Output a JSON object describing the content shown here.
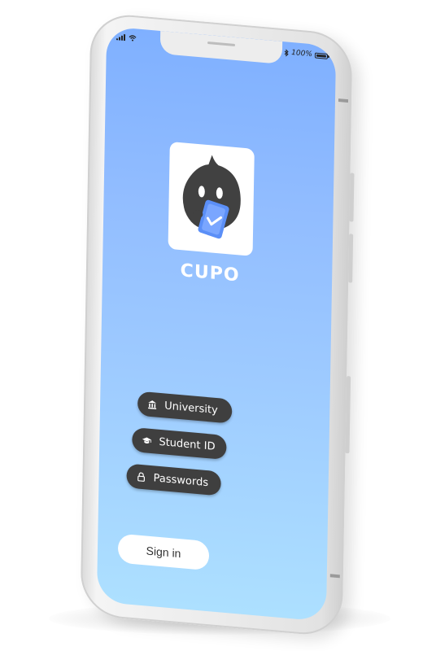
{
  "status_bar": {
    "battery_text": "100%",
    "icons": [
      "signal-icon",
      "wifi-icon",
      "bluetooth-icon",
      "battery-icon"
    ]
  },
  "app": {
    "name": "CUPO",
    "logo_icon": "mascot-logo-icon"
  },
  "login_fields": {
    "university_label": "University",
    "student_id_label": "Student ID",
    "passwords_label": "Passwords"
  },
  "signin_label": "Sign in",
  "colors": {
    "gradient_top": "#7fb0ff",
    "gradient_bottom": "#ade0ff",
    "pill_bg": "#3f3f3f",
    "mascot": "#414141",
    "accent_blue": "#5b8ff7"
  }
}
